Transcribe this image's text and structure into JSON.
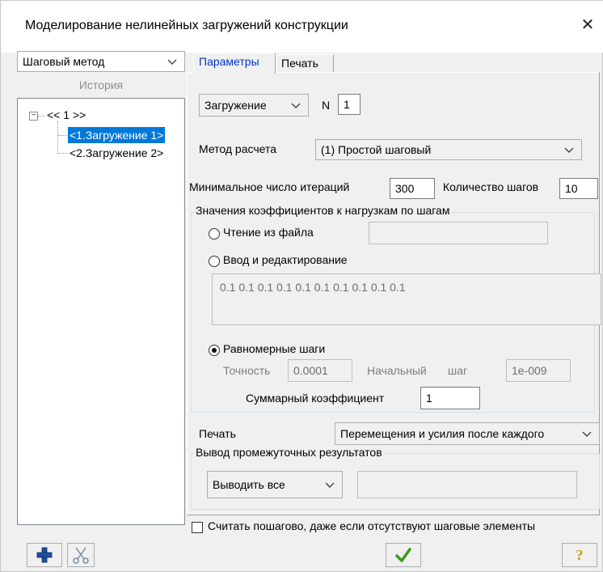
{
  "window": {
    "title": "Моделирование нелинейных загружений конструкции",
    "close_glyph": "✕"
  },
  "left": {
    "method_select": "Шаговый метод",
    "history_label": "История",
    "tree": {
      "root_label": "<< 1 >>",
      "expand_glyph": "−",
      "items": [
        {
          "label": "<1.Загружение 1>",
          "selected": true
        },
        {
          "label": "<2.Загружение 2>",
          "selected": false
        }
      ]
    }
  },
  "tabs": [
    {
      "label": "Параметры",
      "active": true
    },
    {
      "label": "Печать",
      "active": false
    }
  ],
  "params": {
    "load_type_select": "Загружение",
    "n_label": "N",
    "n_value": "1",
    "calc_method_label": "Метод расчета",
    "calc_method_value": "(1) Простой шаговый",
    "min_iter_label": "Минимальное число итераций",
    "min_iter_value": "300",
    "steps_label": "Количество шагов",
    "steps_value": "10",
    "coef_group_title": "Значения коэффициентов к нагрузкам по шагам",
    "read_file_label": "Чтение из файла",
    "read_file_value": "",
    "edit_label": "Ввод и редактирование",
    "coef_text": "0.1 0.1 0.1 0.1 0.1 0.1 0.1 0.1 0.1 0.1",
    "uniform_label": "Равномерные шаги",
    "accuracy_label": "Точность",
    "accuracy_value": "0.0001",
    "initial_step_label_1": "Начальный",
    "initial_step_label_2": "шаг",
    "initial_step_value": "1e-009",
    "sum_coef_label": "Суммарный коэффициент",
    "sum_coef_value": "1",
    "print_label": "Печать",
    "print_value": "Перемещения и усилия после каждого",
    "intermediate_title": "Вывод промежуточных результатов",
    "intermediate_select": "Выводить все",
    "intermediate_value": ""
  },
  "bottom": {
    "checkbox_label": "Считать пошагово, даже если отсутствуют шаговые элементы",
    "checkbox_checked": false,
    "help_glyph": "?"
  },
  "colors": {
    "selection_bg": "#0078d7",
    "add_icon": "#1f4e9c",
    "ok_icon": "#3d9a1f",
    "help_icon": "#c8a000"
  }
}
